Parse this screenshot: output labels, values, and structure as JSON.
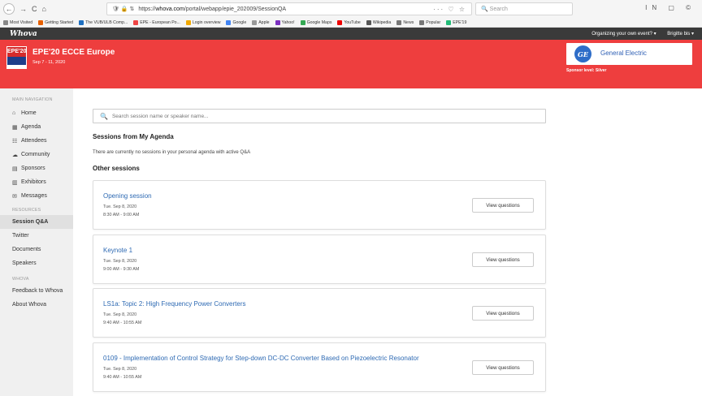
{
  "browser": {
    "back": "←",
    "forward": "→",
    "reload": "C",
    "home": "⌂",
    "url_icons": "🛡 🔒 ⇅",
    "url_prefix": "https://",
    "url_domain": "whova.com",
    "url_path": "/portal/webapp/epie_202009/SessionQA",
    "url_right": "··· ♡ ☆",
    "search_placeholder": "Search",
    "toolbar_right": "IN ▢ ©",
    "bookmarks": [
      {
        "label": "Most Visited",
        "color": "#888888"
      },
      {
        "label": "Getting Started",
        "color": "#e66000"
      },
      {
        "label": "The VUB/ULB Comp...",
        "color": "#1e6fc0"
      },
      {
        "label": "EPE - European Po...",
        "color": "#e44"
      },
      {
        "label": "Login overview",
        "color": "#f2a900"
      },
      {
        "label": "Google",
        "color": "#4285f4"
      },
      {
        "label": "Apple",
        "color": "#999999"
      },
      {
        "label": "Yahoo!",
        "color": "#7b2fbf"
      },
      {
        "label": "Google Maps",
        "color": "#34a853"
      },
      {
        "label": "YouTube",
        "color": "#e00"
      },
      {
        "label": "Wikipedia",
        "color": "#555555"
      },
      {
        "label": "News",
        "color": "#777777"
      },
      {
        "label": "Popular",
        "color": "#777777"
      },
      {
        "label": "EPE'19",
        "color": "#2b7"
      }
    ]
  },
  "header": {
    "logo": "Whova",
    "organizing": "Organizing your own event? ▾",
    "user": "Brigitte bis ▾"
  },
  "event": {
    "logo_text": "EPE'20",
    "title": "EPE'20 ECCE Europe",
    "dates": "Sep 7 - 11, 2020",
    "sponsor_logo": "GE",
    "sponsor_name": "General Electric",
    "sponsor_level": "Sponsor level: Silver",
    "brand_color": "#ee3e3e"
  },
  "sidebar": {
    "main_nav_label": "MAIN NAVIGATION",
    "main_items": [
      {
        "label": "Home",
        "icon": "home-icon",
        "glyph": "⌂"
      },
      {
        "label": "Agenda",
        "icon": "calendar-icon",
        "glyph": "▦"
      },
      {
        "label": "Attendees",
        "icon": "people-icon",
        "glyph": "☷"
      },
      {
        "label": "Community",
        "icon": "chat-icon",
        "glyph": "☁"
      },
      {
        "label": "Sponsors",
        "icon": "sponsor-icon",
        "glyph": "▤"
      },
      {
        "label": "Exhibitors",
        "icon": "exhibitor-icon",
        "glyph": "▥"
      },
      {
        "label": "Messages",
        "icon": "envelope-icon",
        "glyph": "✉"
      }
    ],
    "resources_label": "RESOURCES",
    "resource_items": [
      "Session Q&A",
      "Twitter",
      "Documents",
      "Speakers"
    ],
    "whova_label": "WHOVA",
    "whova_items": [
      "Feedback to Whova",
      "About Whova"
    ]
  },
  "main": {
    "search_placeholder": "Search session name or speaker name...",
    "my_agenda_title": "Sessions from My Agenda",
    "my_agenda_note": "There are currently no sessions in your personal agenda with active Q&A",
    "other_title": "Other sessions",
    "view_label": "View questions",
    "sessions": [
      {
        "title": "Opening session",
        "date": "Tue. Sep 8, 2020",
        "time": "8:30 AM - 9:00 AM"
      },
      {
        "title": "Keynote 1",
        "date": "Tue. Sep 8, 2020",
        "time": "9:00 AM - 9:30 AM"
      },
      {
        "title": "LS1a: Topic 2: High Frequency Power Converters",
        "date": "Tue. Sep 8, 2020",
        "time": "9:40 AM - 10:55 AM"
      },
      {
        "title": "0109 - Implementation of Control Strategy for Step-down DC-DC Converter Based on Piezoelectric Resonator",
        "date": "Tue. Sep 8, 2020",
        "time": "9:40 AM - 10:55 AM"
      }
    ]
  }
}
